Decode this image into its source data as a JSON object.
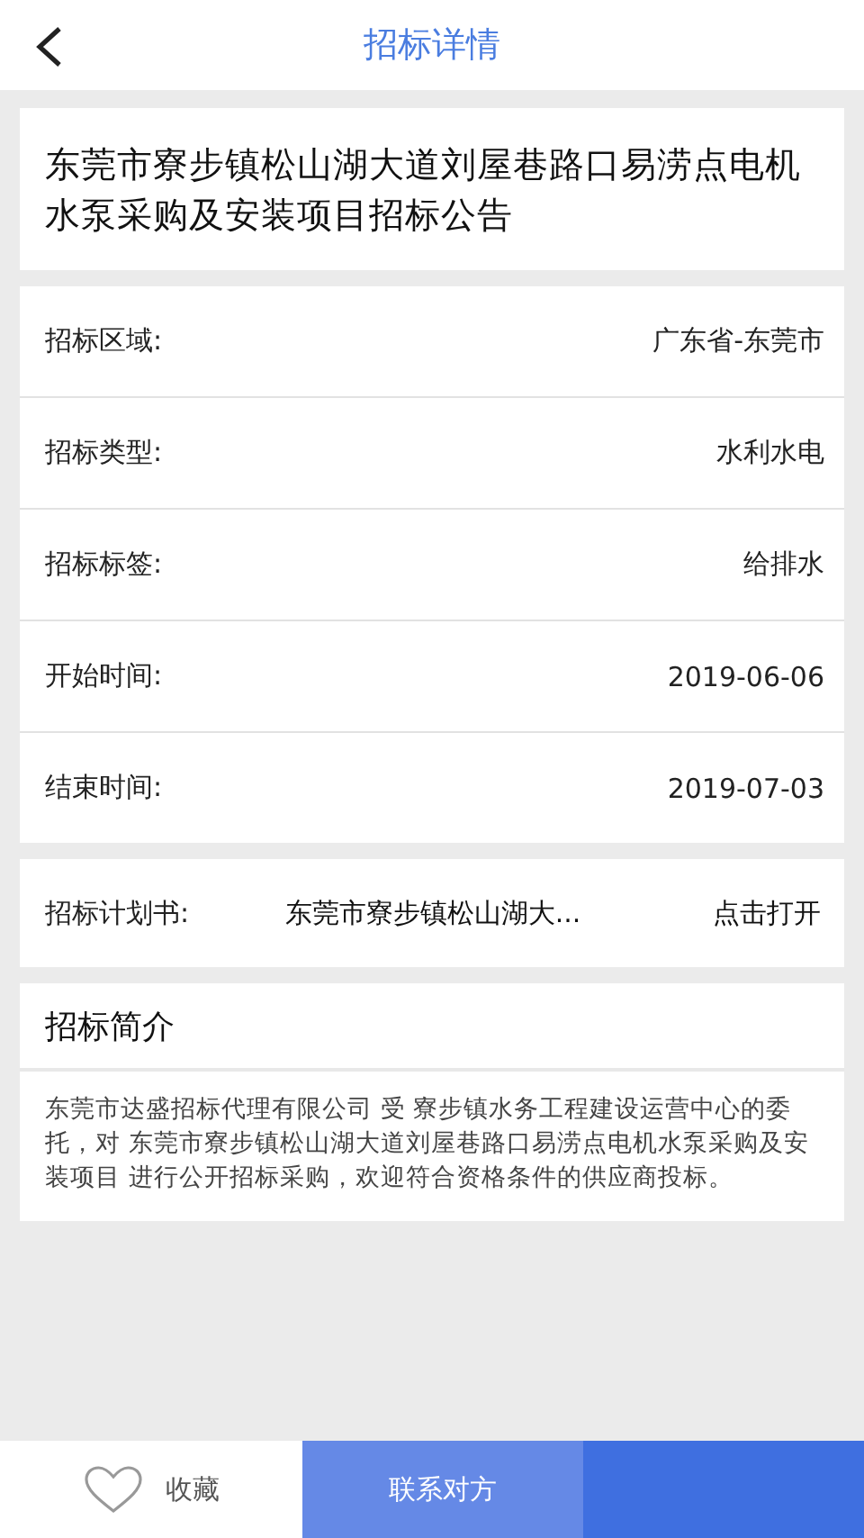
{
  "header": {
    "title": "招标详情"
  },
  "notice_title": "东莞市寮步镇松山湖大道刘屋巷路口易涝点电机水泵采购及安装项目招标公告",
  "details": [
    {
      "label": "招标区域:",
      "value": "广东省-东莞市"
    },
    {
      "label": "招标类型:",
      "value": "水利水电"
    },
    {
      "label": "招标标签:",
      "value": "给排水"
    },
    {
      "label": "开始时间:",
      "value": "2019-06-06"
    },
    {
      "label": "结束时间:",
      "value": "2019-07-03"
    }
  ],
  "plan": {
    "label": "招标计划书:",
    "file": "东莞市寮步镇松山湖大...",
    "action": "点击打开"
  },
  "intro": {
    "heading": "招标简介",
    "text": " 东莞市达盛招标代理有限公司  受 寮步镇水务工程建设运营中心的委托，对 东莞市寮步镇松山湖大道刘屋巷路口易涝点电机水泵采购及安装项目 进行公开招标采购，欢迎符合资格条件的供应商投标。"
  },
  "bottom_bar": {
    "favorite": {
      "label": "收藏",
      "favorited": false
    },
    "contact": {
      "label": "联系对方"
    }
  }
}
